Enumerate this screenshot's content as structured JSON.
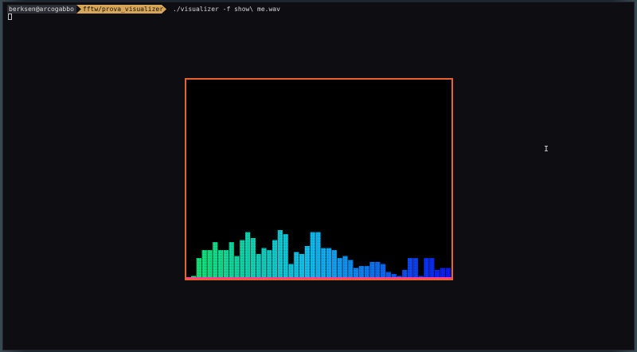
{
  "terminal": {
    "prompt_user": "berksen@arcogabbo",
    "prompt_dir": "fftw/prova_visualizer",
    "command": "./visualizer -f show\\ me.wav"
  },
  "visualizer": {
    "bar_heights": [
      0.01,
      0.1,
      0.14,
      0.14,
      0.18,
      0.14,
      0.14,
      0.18,
      0.11,
      0.19,
      0.23,
      0.2,
      0.12,
      0.15,
      0.14,
      0.19,
      0.24,
      0.22,
      0.07,
      0.13,
      0.12,
      0.16,
      0.23,
      0.23,
      0.15,
      0.15,
      0.14,
      0.1,
      0.11,
      0.09,
      0.05,
      0.06,
      0.06,
      0.08,
      0.08,
      0.07,
      0.03,
      0.02,
      0.01,
      0.04,
      0.1,
      0.1,
      0.01,
      0.1,
      0.1,
      0.04,
      0.05,
      0.05,
      0.04
    ],
    "gradient_start": "#00f07a",
    "gradient_mid": "#00c8ff",
    "gradient_end": "#0a14ff",
    "border_color": "#e8622c",
    "baseline_color": "#ff3c9a"
  }
}
